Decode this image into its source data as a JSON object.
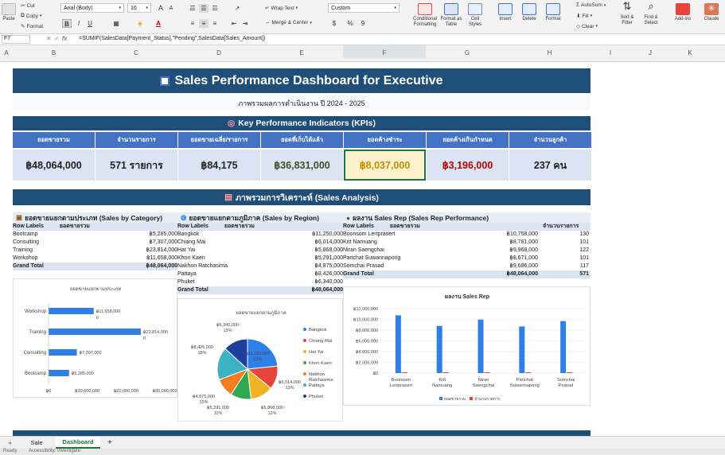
{
  "ribbon": {
    "cut": "Cut",
    "copy": "Copy",
    "format": "Format",
    "paste": "Paste",
    "font_name": "Arial (Body)",
    "font_size": "16",
    "wrap_text": "Wrap Text",
    "merge_center": "Merge & Center",
    "number_format": "Custom",
    "percent": "%",
    "comma": "9",
    "cond_fmt": "Conditional Formatting",
    "fmt_table": "Format as Table",
    "cell_styles": "Cell Styles",
    "insert": "Insert",
    "delete": "Delete",
    "format_cells": "Format",
    "autosum": "AutoSum",
    "fill": "Fill",
    "clear": "Clear",
    "sort_filter": "Sort & Filter",
    "find_select": "Find & Select",
    "addins": "Add-ins",
    "claude": "Claude",
    "bold": "B",
    "italic": "I",
    "underline": "U",
    "fontA": "A",
    "grow": "A",
    "shrink": "A"
  },
  "formula_bar": {
    "cell_ref": "F7",
    "fx": "fx",
    "formula": "=SUMIF(SalesData[Payment_Status],\"Pending\",SalesData[Sales_Amount])"
  },
  "columns": [
    "A",
    "B",
    "C",
    "D",
    "E",
    "F",
    "G",
    "H",
    "I",
    "J",
    "K"
  ],
  "dashboard": {
    "title": "Sales Performance Dashboard for Executive",
    "subtitle": "ภาพรวมผลการดำเนินงาน ปี 2024 - 2025",
    "kpi_header": "Key Performance Indicators (KPIs)",
    "kpis": [
      {
        "label": "ยอดขายรวม",
        "value": "฿48,064,000",
        "color": "#222222"
      },
      {
        "label": "จำนวนรายการ",
        "value": "571 รายการ",
        "color": "#222222"
      },
      {
        "label": "ยอดขายเฉลี่ย/รายการ",
        "value": "฿84,175",
        "color": "#222222"
      },
      {
        "label": "ยอดที่เก็บได้แล้ว",
        "value": "฿36,831,000",
        "color": "#375623"
      },
      {
        "label": "ยอดค้างชำระ",
        "value": "฿8,037,000",
        "color": "#bf8f00"
      },
      {
        "label": "ยอดค้างเกินกำหนด",
        "value": "฿3,196,000",
        "color": "#c00000"
      },
      {
        "label": "จำนวนลูกค้า",
        "value": "237 คน",
        "color": "#222222"
      }
    ],
    "analysis_header": "ภาพรวมการวิเคราะห์ (Sales Analysis)"
  },
  "pivots": {
    "category": {
      "title": "ยอดขายแยกตามประเภท (Sales by Category)",
      "col1": "Row Labels",
      "col2": "ยอดขายรวม",
      "rows": [
        [
          "Bootcamp",
          "฿5,285,000"
        ],
        [
          "Consulting",
          "฿7,307,000"
        ],
        [
          "Training",
          "฿23,814,000"
        ],
        [
          "Workshop",
          "฿11,658,000"
        ]
      ],
      "total": [
        "Grand Total",
        "฿48,064,000"
      ]
    },
    "region": {
      "title": "ยอดขายแยกตามภูมิภาค (Sales by Region)",
      "col1": "Row Labels",
      "col2": "ยอดขายรวม",
      "rows": [
        [
          "Bangkok",
          "฿11,250,000"
        ],
        [
          "Chiang Mai",
          "฿6,014,000"
        ],
        [
          "Hat Yai",
          "฿5,868,000"
        ],
        [
          "Khon Kaen",
          "฿5,291,000"
        ],
        [
          "Nakhon Ratchasima",
          "฿4,875,000"
        ],
        [
          "Pattaya",
          "฿8,426,000"
        ],
        [
          "Phuket",
          "฿6,340,000"
        ]
      ],
      "total": [
        "Grand Total",
        "฿48,064,000"
      ]
    },
    "rep": {
      "title": "ผลงาน Sales Rep (Sales Rep Performance)",
      "col1": "Row Labels",
      "col2": "ยอดขายรวม",
      "col3": "จำนวนรายการ",
      "rows": [
        [
          "Boonsom Lertprasert",
          "฿10,758,000",
          "130"
        ],
        [
          "Krit Namuang",
          "฿8,781,000",
          "101"
        ],
        [
          "Niran Saengchai",
          "฿9,968,000",
          "122"
        ],
        [
          "Parichat Suwannapong",
          "฿8,671,000",
          "101"
        ],
        [
          "Somchai Prasad",
          "฿9,686,000",
          "117"
        ]
      ],
      "total": [
        "Grand Total",
        "฿48,064,000",
        "571"
      ]
    }
  },
  "chart_data": [
    {
      "type": "bar",
      "orientation": "horizontal",
      "title": "ยอดขายแยกตามประเภท",
      "categories": [
        "Bootcamp",
        "Consulting",
        "Training",
        "Workshop"
      ],
      "values": [
        5285000,
        7307000,
        23814000,
        11658000
      ],
      "data_labels": [
        "฿5,285,000",
        "฿7,307,000",
        "฿23,814,000\n0",
        "฿11,658,000\n0"
      ],
      "xlim": [
        0,
        30000000
      ],
      "xticks": [
        "฿0",
        "฿10,000,000",
        "฿20,000,000",
        "฿30,000,000"
      ],
      "color": "#2f7fe8"
    },
    {
      "type": "pie",
      "title": "ยอดขายแยกตามภูมิภาค",
      "categories": [
        "Bangkok",
        "Chiang Mai",
        "Hat Yai",
        "Khon Kaen",
        "Nakhon Ratchasima",
        "Pattaya",
        "Phuket"
      ],
      "values": [
        11250000,
        6014000,
        5868000,
        5291000,
        4875000,
        8426000,
        6340000
      ],
      "labels": [
        "฿11,250,000, 23%",
        "฿6,014,000, 13%",
        "฿5,868,000, 12%",
        "฿5,291,000, 11%",
        "฿4,875,000, 10%",
        "฿8,426,000, 18%",
        "฿6,340,000, 13%"
      ],
      "colors": [
        "#2f7fe8",
        "#e8443a",
        "#f0b323",
        "#2fa84f",
        "#f47d20",
        "#3bb3c3",
        "#1f3f9c"
      ],
      "legend": "right"
    },
    {
      "type": "bar",
      "title": "ผลงาน Sales Rep",
      "categories": [
        "Boonsom Lertprasert",
        "Krit Namuang",
        "Niran Saengchai",
        "Parichat Suwannapong",
        "Somchai Prasad"
      ],
      "series": [
        {
          "name": "ยอดขายรวม",
          "values": [
            10758000,
            8781000,
            9968000,
            8671000,
            9686000
          ],
          "color": "#2f7fe8"
        },
        {
          "name": "จำนวนรายการ",
          "values": [
            130,
            101,
            122,
            101,
            117
          ],
          "color": "#e8443a"
        }
      ],
      "ylim": [
        0,
        12000000
      ],
      "yticks": [
        "฿0",
        "฿2,000,000",
        "฿4,000,000",
        "฿6,000,000",
        "฿8,000,000",
        "฿10,000,000",
        "฿12,000,000"
      ],
      "legend": "bottom"
    }
  ],
  "tabs": {
    "sheet1": "Sale",
    "sheet2": "Dashboard",
    "add": "+"
  },
  "status": {
    "ready": "Ready",
    "accessibility": "Accessibility: Investigate"
  }
}
